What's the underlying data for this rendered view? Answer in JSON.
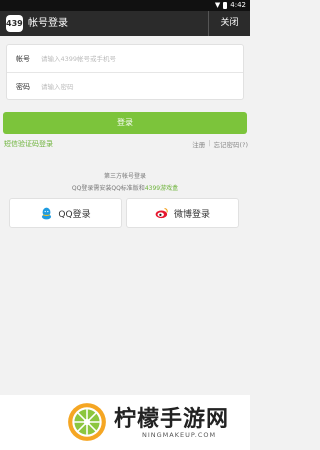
{
  "status_bar": {
    "time": "4:42"
  },
  "app_bar": {
    "logo_text": "4399",
    "title": "帐号登录",
    "close_label": "关闭"
  },
  "login_form": {
    "account_label": "帐号",
    "account_placeholder": "请输入4399帐号或手机号",
    "password_label": "密码",
    "password_placeholder": "请输入密码"
  },
  "login_button": "登录",
  "links": {
    "sms_login": "短信验证码登录",
    "register": "注册",
    "separator": "|",
    "forgot_password": "忘记密码(?)"
  },
  "third_party": {
    "title": "第三方帐号登录",
    "hint_prefix": "QQ登录需安装QQ标准版和",
    "hint_highlight": "4399游戏盒",
    "qq_label": "QQ登录",
    "weibo_label": "微博登录"
  },
  "watermark": {
    "text": "柠檬手游网",
    "url": "NINGMAKEUP.COM"
  },
  "colors": {
    "accent": "#7cc43b",
    "link_green": "#6db33a",
    "app_bar": "#2b2b2b"
  }
}
